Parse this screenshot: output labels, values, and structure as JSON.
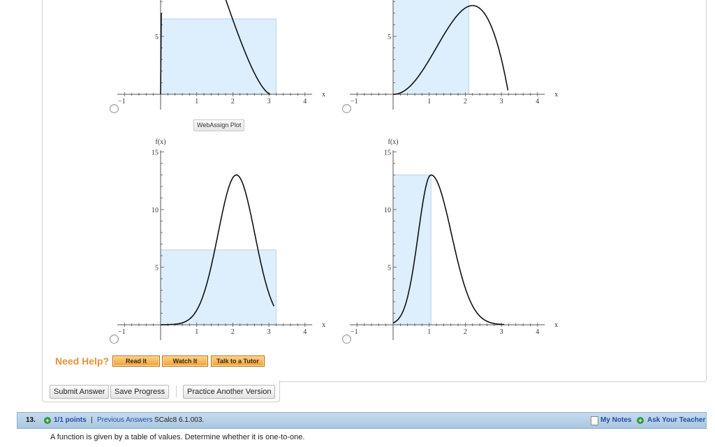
{
  "plots": {
    "caption": "WebAssign Plot",
    "func_label": "f(x)",
    "x_label": "x",
    "x_ticks": [
      "−1",
      "1",
      "2",
      "3",
      "4"
    ],
    "y_ticks": [
      "5",
      "10",
      "15"
    ],
    "x_label_values": [
      -1,
      1,
      2,
      3,
      4
    ],
    "y_label_values": [
      5,
      10,
      15
    ],
    "panels": [
      {
        "name": "plot-top-left",
        "xmin": -1.2,
        "xmax": 4.2,
        "ymin": 0,
        "ymax": 10,
        "show_func_label": false,
        "y_tick_labels": [
          5
        ],
        "rect": {
          "x0": 0,
          "x1": 3.2,
          "h": 6.5
        },
        "curve": "a"
      },
      {
        "name": "plot-top-right",
        "xmin": -1.2,
        "xmax": 4.2,
        "ymin": 0,
        "ymax": 10,
        "show_func_label": false,
        "y_tick_labels": [
          5
        ],
        "rect": {
          "x0": 0,
          "x1": 2.1,
          "h": 13
        },
        "curve": "b"
      },
      {
        "name": "plot-bottom-left",
        "xmin": -1.2,
        "xmax": 4.2,
        "ymin": 0,
        "ymax": 16,
        "show_func_label": true,
        "y_tick_labels": [
          5,
          10,
          15
        ],
        "rect": {
          "x0": 0,
          "x1": 3.2,
          "h": 6.5
        },
        "curve": "c"
      },
      {
        "name": "plot-bottom-right",
        "xmin": -1.2,
        "xmax": 4.2,
        "ymin": 0,
        "ymax": 16,
        "show_func_label": true,
        "y_tick_labels": [
          5,
          10,
          15
        ],
        "rect": {
          "x0": 0,
          "x1": 1.05,
          "h": 13
        },
        "curve": "d"
      }
    ]
  },
  "help": {
    "title": "Need Help?",
    "read_it": "Read It",
    "watch_it": "Watch It",
    "talk_to_tutor": "Talk to a Tutor"
  },
  "actions": {
    "submit": "Submit Answer",
    "save": "Save Progress",
    "practice": "Practice Another Version"
  },
  "question": {
    "number": "13.",
    "points": "1/1 points",
    "separator": "|",
    "previous_answers": "Previous Answers",
    "source": "SCalc8 6.1.003.",
    "my_notes": "My Notes",
    "ask_teacher": "Ask Your Teacher",
    "prompt": "A function is given by a table of values. Determine whether it is one-to-one."
  },
  "colors": {
    "fill": "#ddeefd",
    "fill_stroke": "#b9d4ea",
    "help_orange": "#e8913a",
    "bar_blue": "#b6cfe5",
    "link_blue": "#1f4fa8",
    "plus_green": "#2f9a3d"
  }
}
